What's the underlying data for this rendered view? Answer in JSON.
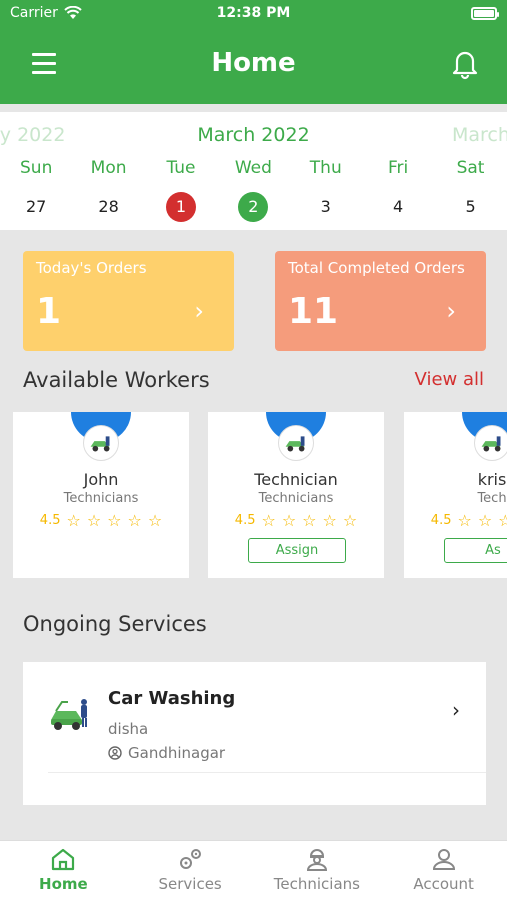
{
  "status_bar": {
    "carrier": "Carrier",
    "time": "12:38 PM"
  },
  "header": {
    "title": "Home",
    "menu_icon": "hamburger-menu-icon",
    "notification_icon": "bell-icon"
  },
  "calendar": {
    "prev_month": "ry 2022",
    "month": "March 2022",
    "next_month": "March",
    "days": [
      {
        "name": "Sun",
        "date": "27"
      },
      {
        "name": "Mon",
        "date": "28"
      },
      {
        "name": "Tue",
        "date": "1",
        "marker": "red"
      },
      {
        "name": "Wed",
        "date": "2",
        "marker": "green"
      },
      {
        "name": "Thu",
        "date": "3"
      },
      {
        "name": "Fri",
        "date": "4"
      },
      {
        "name": "Sat",
        "date": "5"
      }
    ],
    "colors": {
      "red": "#d32f2f",
      "green": "#3daa4a"
    }
  },
  "orders": {
    "today": {
      "label": "Today's Orders",
      "count": "1",
      "color": "#fed06c"
    },
    "completed": {
      "label": "Total Completed Orders",
      "count": "11",
      "color": "#f59c7c"
    }
  },
  "workers": {
    "title": "Available Workers",
    "view_all": "View all",
    "items": [
      {
        "name": "John",
        "role": "Technicians",
        "rating": "4.5",
        "assign": ""
      },
      {
        "name": "Technician",
        "role": "Technicians",
        "rating": "4.5",
        "assign": "Assign"
      },
      {
        "name": "kris",
        "role": "Tech",
        "rating": "4.5",
        "assign": "As"
      }
    ]
  },
  "ongoing": {
    "title": "Ongoing Services",
    "items": [
      {
        "service": "Car Washing",
        "customer": "disha",
        "location": "Gandhinagar"
      }
    ]
  },
  "tabbar": [
    {
      "label": "Home",
      "icon": "home-icon",
      "active": true
    },
    {
      "label": "Services",
      "icon": "gears-icon",
      "active": false
    },
    {
      "label": "Technicians",
      "icon": "technician-icon",
      "active": false
    },
    {
      "label": "Account",
      "icon": "person-icon",
      "active": false
    }
  ],
  "theme": {
    "primary": "#3daa4a",
    "accent_red": "#d32f2f"
  }
}
